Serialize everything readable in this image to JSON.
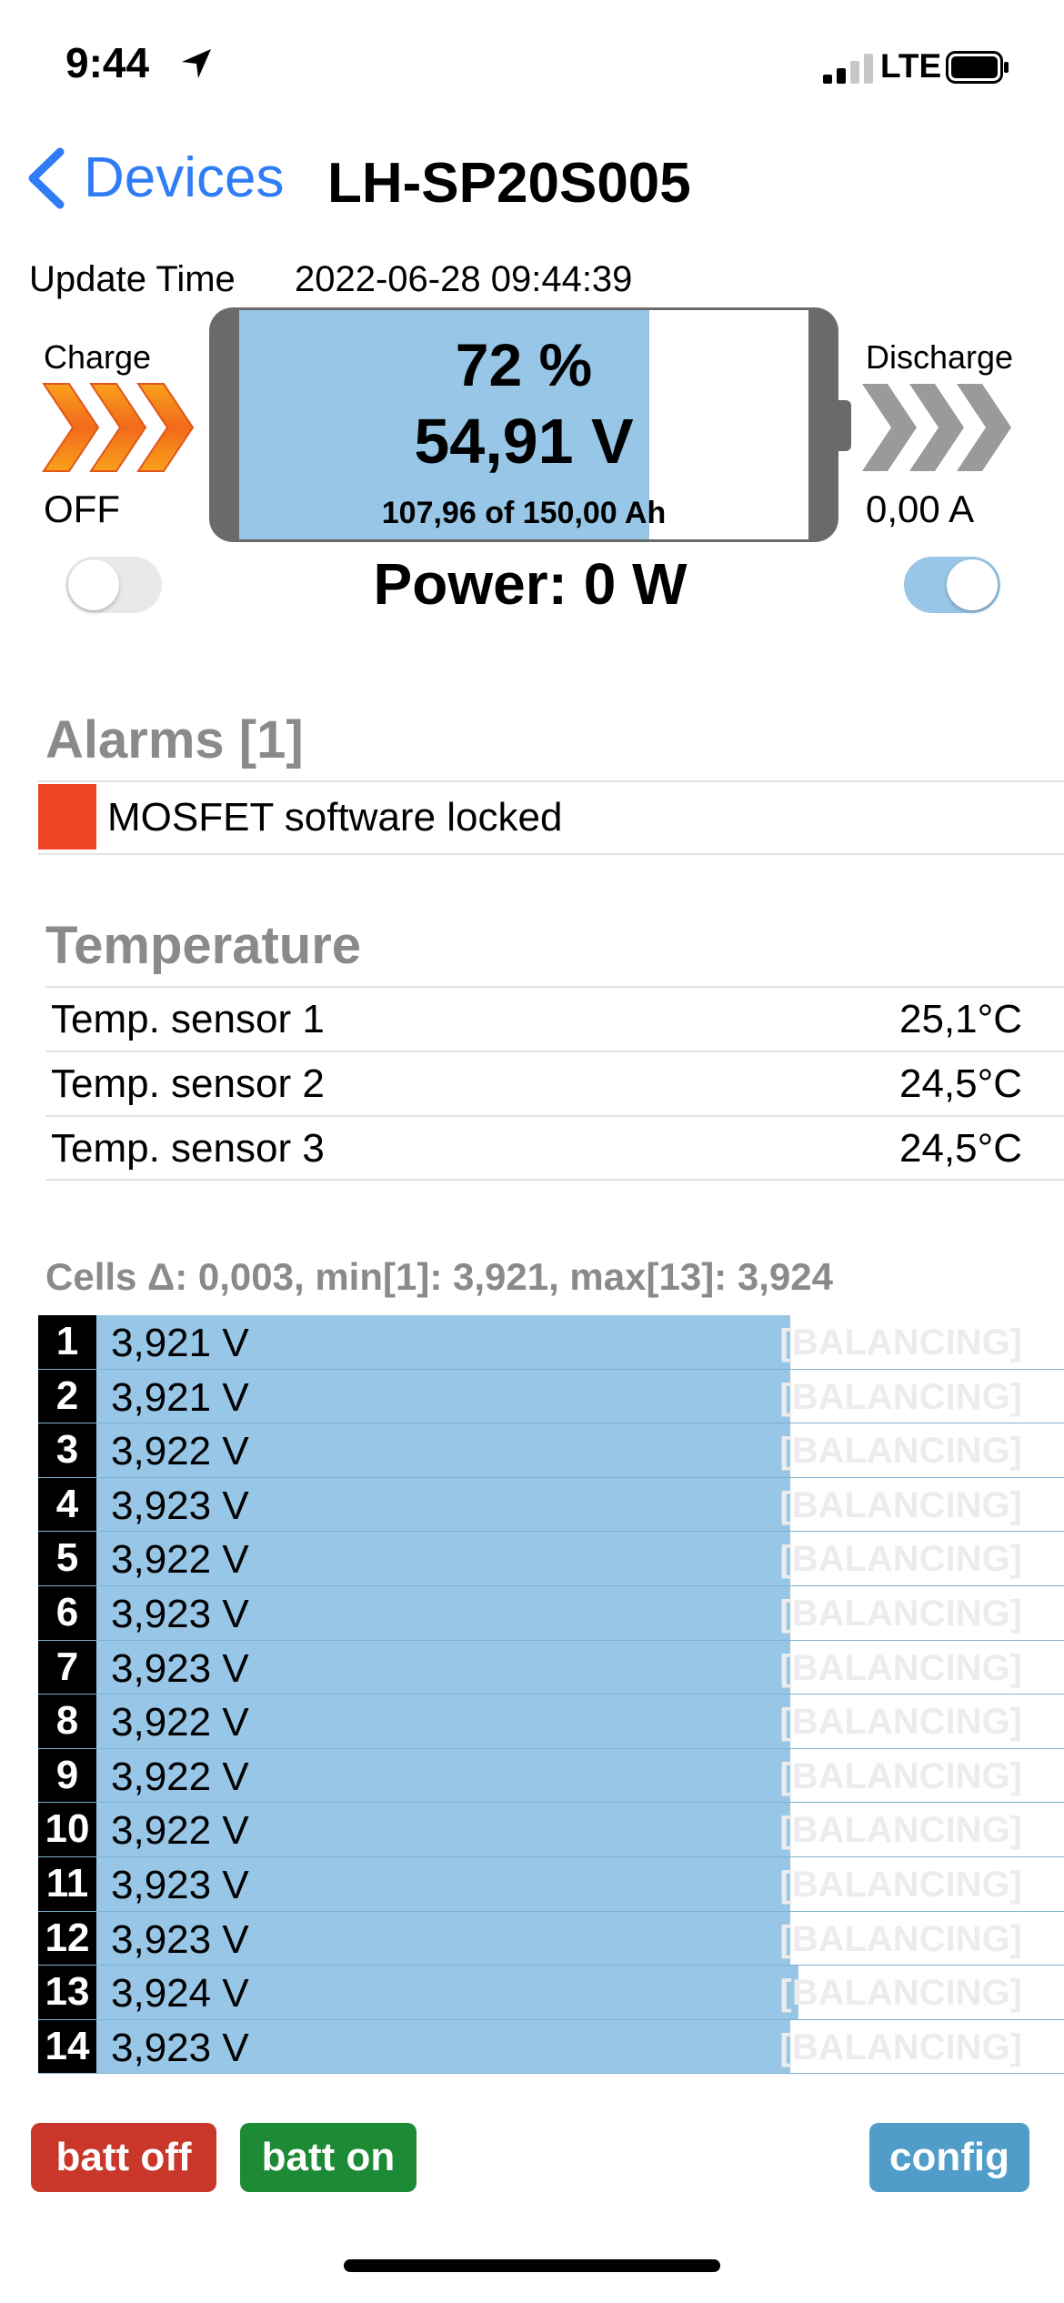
{
  "status_bar": {
    "time": "9:44",
    "network": "LTE"
  },
  "nav": {
    "back_label": "Devices",
    "title": "LH-SP20S005"
  },
  "update": {
    "label": "Update Time",
    "value": "2022-06-28 09:44:39"
  },
  "battery": {
    "percent_text": "72 %",
    "voltage_text": "54,91 V",
    "capacity_text": "107,96 of 150,00 Ah",
    "soc_fraction": 0.72,
    "charge_label": "Charge",
    "charge_state": "OFF",
    "discharge_label": "Discharge",
    "discharge_current": "0,00 A",
    "power_text": "Power: 0 W",
    "charge_switch_on": false,
    "discharge_switch_on": true
  },
  "alarms": {
    "title": "Alarms [1]",
    "items": [
      "MOSFET software locked"
    ],
    "color": "#ee4524"
  },
  "temperature": {
    "title": "Temperature",
    "sensors": [
      {
        "name": "Temp. sensor 1",
        "value": "25,1°C"
      },
      {
        "name": "Temp. sensor 2",
        "value": "24,5°C"
      },
      {
        "name": "Temp. sensor 3",
        "value": "24,5°C"
      }
    ]
  },
  "cells": {
    "header": "Cells Δ: 0,003, min[1]: 3,921, max[13]: 3,924",
    "balancing_label": "[BALANCING]",
    "items": [
      {
        "index": "1",
        "voltage": "3,921 V",
        "level": 0.988
      },
      {
        "index": "2",
        "voltage": "3,921 V",
        "level": 0.988
      },
      {
        "index": "3",
        "voltage": "3,922 V",
        "level": 0.988
      },
      {
        "index": "4",
        "voltage": "3,923 V",
        "level": 0.988
      },
      {
        "index": "5",
        "voltage": "3,922 V",
        "level": 0.988
      },
      {
        "index": "6",
        "voltage": "3,923 V",
        "level": 0.988
      },
      {
        "index": "7",
        "voltage": "3,923 V",
        "level": 0.988
      },
      {
        "index": "8",
        "voltage": "3,922 V",
        "level": 0.988
      },
      {
        "index": "9",
        "voltage": "3,922 V",
        "level": 0.988
      },
      {
        "index": "10",
        "voltage": "3,922 V",
        "level": 0.988
      },
      {
        "index": "11",
        "voltage": "3,923 V",
        "level": 0.988
      },
      {
        "index": "12",
        "voltage": "3,923 V",
        "level": 0.988
      },
      {
        "index": "13",
        "voltage": "3,924 V",
        "level": 1.0
      },
      {
        "index": "14",
        "voltage": "3,923 V",
        "level": 0.988
      }
    ]
  },
  "buttons": {
    "batt_off": "batt off",
    "batt_on": "batt on",
    "config": "config"
  },
  "colors": {
    "accent_blue": "#2f7cf6",
    "fill_blue": "#97c6e6",
    "alarm_red": "#ee4524",
    "btn_red": "#c8372a",
    "btn_green": "#1d8a36",
    "btn_cfg": "#4f9dc8"
  }
}
